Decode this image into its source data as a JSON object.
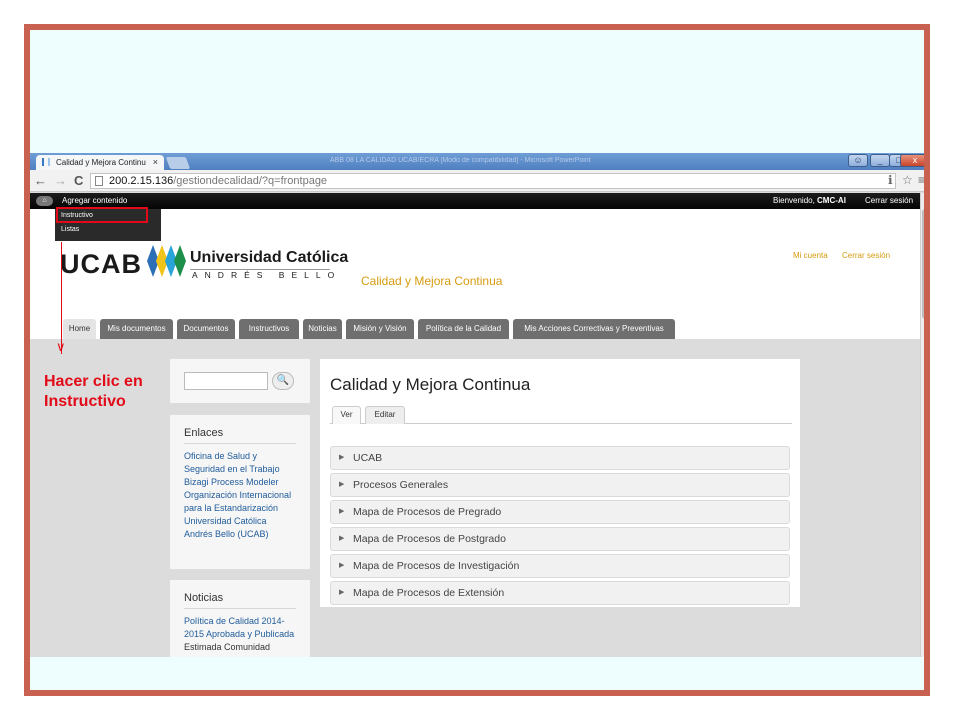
{
  "browser": {
    "tab_title": "Calidad y Mejora Continu",
    "tab_close": "×",
    "window_title": "ABB 08 LA CALIDAD UCAB/ECRA [Modo de compatibilidad] - Microsoft PowerPoint",
    "url_host": "200.2.15.136",
    "url_path": "/gestiondecalidad/?q=frontpage",
    "back": "←",
    "forward": "→",
    "reload": "C",
    "wrench": "ℹ",
    "star": "☆",
    "menu": "≡",
    "minimize": "_",
    "maximize": "□",
    "close": "x"
  },
  "adminbar": {
    "home": "⌂",
    "add_content": "Agregar contenido",
    "welcome_prefix": "Bienvenido, ",
    "welcome_user": "CMC-AI",
    "logout": "Cerrar sesión",
    "dropdown": [
      "Instructivo",
      "Listas"
    ]
  },
  "header": {
    "logo_text": "UCAB",
    "university_name": "Universidad Católica",
    "university_sub": "ANDRÉS BELLO",
    "site_name": "Calidad y Mejora Continua",
    "user_links": [
      "Mi cuenta",
      "Cerrar sesión"
    ]
  },
  "nav": [
    "Home",
    "Mis documentos",
    "Documentos",
    "Instructivos",
    "Noticias",
    "Misión y Visión",
    "Política de la Calidad",
    "Mis Acciones Correctivas y Preventivas"
  ],
  "sidebar": {
    "search_icon": "🔍",
    "enlaces_title": "Enlaces",
    "enlaces": [
      "Oficina de Salud y Seguridad en el Trabajo",
      "Bizagi Process Modeler",
      "Organización Internacional para la Estandarización",
      "Universidad Católica Andrés Bello (UCAB)"
    ],
    "noticias_title": "Noticias",
    "noticias_link": "Política de Calidad 2014-2015 Aprobada y Publicada",
    "noticias_text": "Estimada Comunidad"
  },
  "main": {
    "title": "Calidad y Mejora Continua",
    "tabs": [
      "Ver",
      "Editar"
    ],
    "accordion": [
      "UCAB",
      "Procesos Generales",
      "Mapa de Procesos de Pregrado",
      "Mapa de Procesos de Postgrado",
      "Mapa de Procesos de Investigación",
      "Mapa de Procesos de Extensión"
    ]
  },
  "annotation": {
    "line1": "Hacer clic en",
    "line2": "Instructivo"
  },
  "colors": {
    "slide_bg": "#eefdfd",
    "slide_border": "#c8614f",
    "annotation": "#e20a18",
    "site_accent": "#d69b10",
    "link": "#1f5b9a"
  }
}
